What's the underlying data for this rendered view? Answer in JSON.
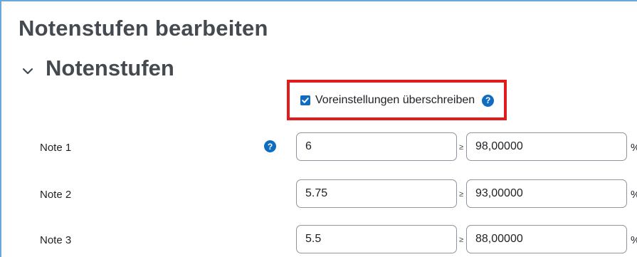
{
  "page_title": "Notenstufen bearbeiten",
  "section": {
    "title": "Notenstufen",
    "icon": "chevron-down-icon",
    "expanded": true
  },
  "override": {
    "label": "Voreinstellungen überschreiben",
    "checked": true,
    "help_icon": "help-icon"
  },
  "grades": [
    {
      "label": "Note 1",
      "grade": "6",
      "ge": "≥",
      "percent": "98,00000",
      "unit": "%",
      "has_help": true
    },
    {
      "label": "Note 2",
      "grade": "5.75",
      "ge": "≥",
      "percent": "93,00000",
      "unit": "%",
      "has_help": false
    },
    {
      "label": "Note 3",
      "grade": "5.5",
      "ge": "≥",
      "percent": "88,00000",
      "unit": "%",
      "has_help": false
    }
  ],
  "colors": {
    "accent": "#0f6cbf",
    "highlight": "#e01b1b",
    "heading": "#444a50",
    "frame": "#6aa6d9"
  }
}
